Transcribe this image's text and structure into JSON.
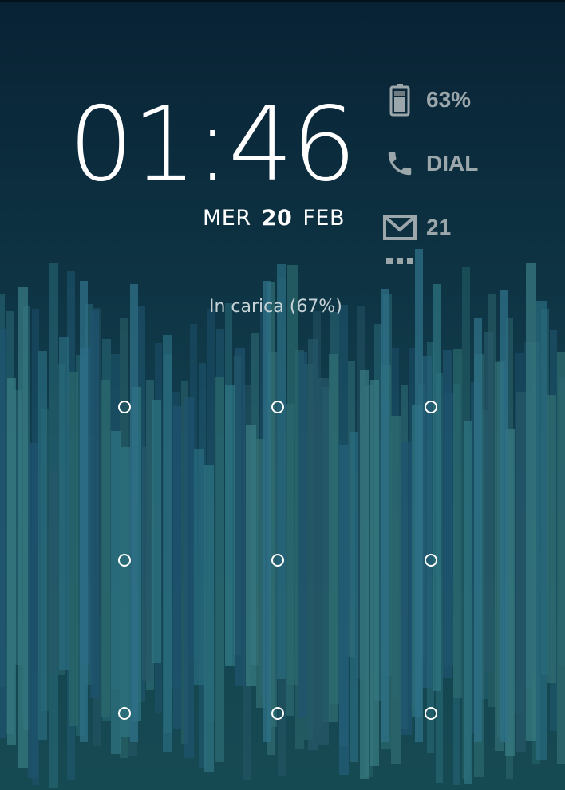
{
  "lockscreen": {
    "time": "01:46",
    "date": {
      "weekday": "MER",
      "day": "20",
      "month": "FEB"
    },
    "charging_status": "In carica (67%)"
  },
  "widgets": {
    "battery": {
      "icon": "battery-icon",
      "label": "63%"
    },
    "dial": {
      "icon": "phone-icon",
      "label": "DIAL"
    },
    "mail": {
      "icon": "gmail-icon",
      "label": "21"
    },
    "more": {
      "icon": "more-dots-icon"
    }
  },
  "pattern_grid": {
    "rows": 3,
    "columns": 3
  },
  "colors": {
    "text": "#ffffff",
    "widget_text": "#9ca7ab",
    "status_text": "#c7d2d6"
  }
}
